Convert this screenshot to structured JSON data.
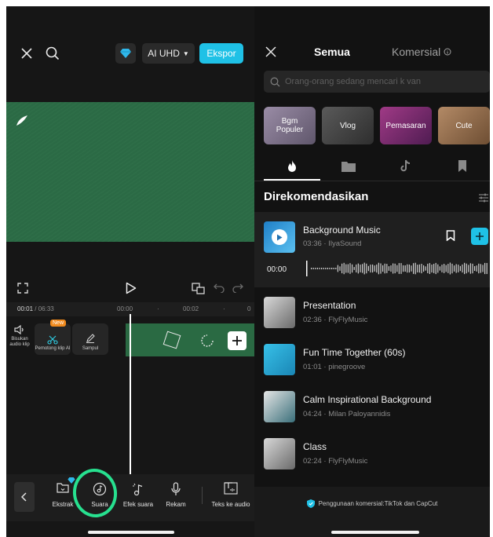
{
  "left": {
    "header": {
      "quality_label": "AI UHD",
      "export_label": "Ekspor"
    },
    "timeline": {
      "current_time": "00:01",
      "total_time": "06:33",
      "ticks": [
        "00:00",
        "00:02"
      ]
    },
    "clip_tools": [
      {
        "label": "Bisukan audio klip"
      },
      {
        "label": "Pemotong klip AI",
        "badge": "New"
      },
      {
        "label": "Sampul"
      }
    ],
    "bottom_bar": [
      {
        "label": "Ekstrak"
      },
      {
        "label": "Suara"
      },
      {
        "label": "Efek suara"
      },
      {
        "label": "Rekam"
      },
      {
        "label": "Teks ke audio"
      }
    ]
  },
  "right": {
    "tabs": {
      "all": "Semua",
      "commercial": "Komersial"
    },
    "search": {
      "placeholder": "Orang-orang sedang mencari k van"
    },
    "categories": [
      {
        "label": "Bgm Populer",
        "color": "#7a6f86"
      },
      {
        "label": "Vlog",
        "color": "#4b4b4b"
      },
      {
        "label": "Pemasaran",
        "color": "#7a2a63"
      },
      {
        "label": "Cute",
        "color": "#8d6a4c"
      }
    ],
    "section_title": "Direkomendasikan",
    "featured": {
      "title": "Background Music",
      "meta": "03:36 · IlyaSound",
      "time": "00:00"
    },
    "tracks": [
      {
        "title": "Presentation",
        "meta": "02:36 · FlyFlyMusic"
      },
      {
        "title": "Fun Time Together (60s)",
        "meta": "01:01 · pinegroove"
      },
      {
        "title": "Calm Inspirational Background",
        "meta": "04:24 · Milan Paloyannidis"
      },
      {
        "title": "Class",
        "meta": "02:24 · FlyFlyMusic"
      }
    ],
    "footer_text": "Penggunaan komersial:TikTok dan CapCut",
    "accent_color": "#1fc1e6",
    "highlight_color": "#27e08f"
  }
}
